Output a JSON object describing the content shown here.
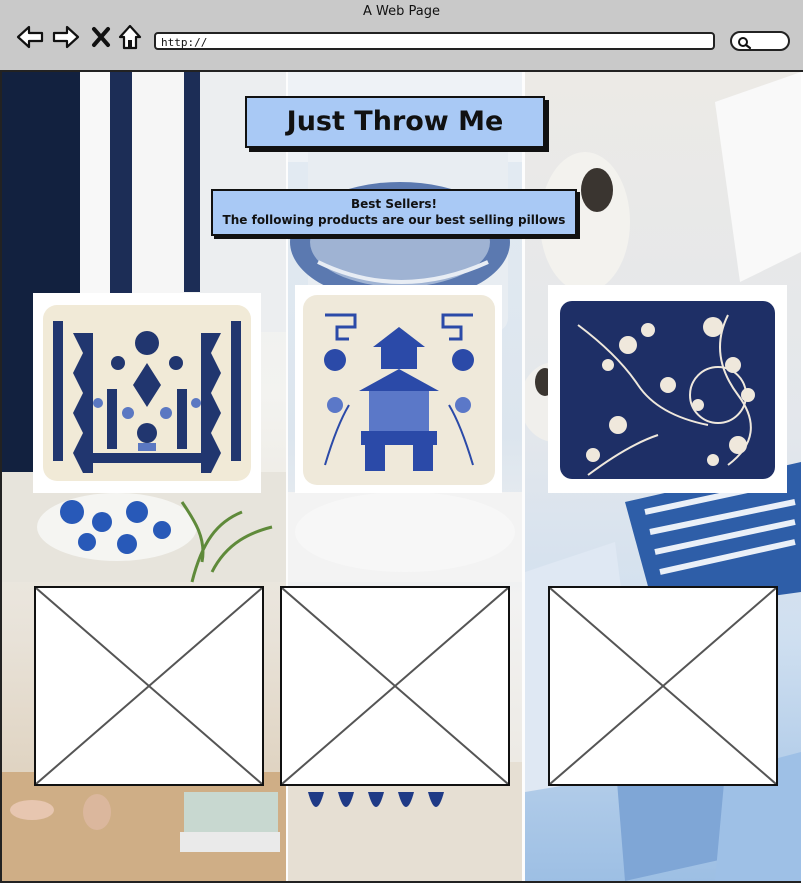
{
  "window": {
    "title": "A Web Page"
  },
  "browser": {
    "url": "http://",
    "icons": [
      "back-arrow-icon",
      "forward-arrow-icon",
      "close-icon",
      "home-icon",
      "search-icon"
    ]
  },
  "page": {
    "title": "Just Throw Me",
    "best_sellers": {
      "heading": "Best Sellers!",
      "description": "The following products are our best selling pillows"
    }
  },
  "products": [
    {
      "pattern": "ikat",
      "colors": [
        "#21366f",
        "#f1ead7"
      ]
    },
    {
      "pattern": "chinoiserie-pagoda",
      "colors": [
        "#2b4aa8",
        "#efe9da"
      ]
    },
    {
      "pattern": "floral-toile",
      "colors": [
        "#1e2f66",
        "#efe8dc"
      ]
    }
  ],
  "placeholders": [
    {},
    {},
    {}
  ]
}
